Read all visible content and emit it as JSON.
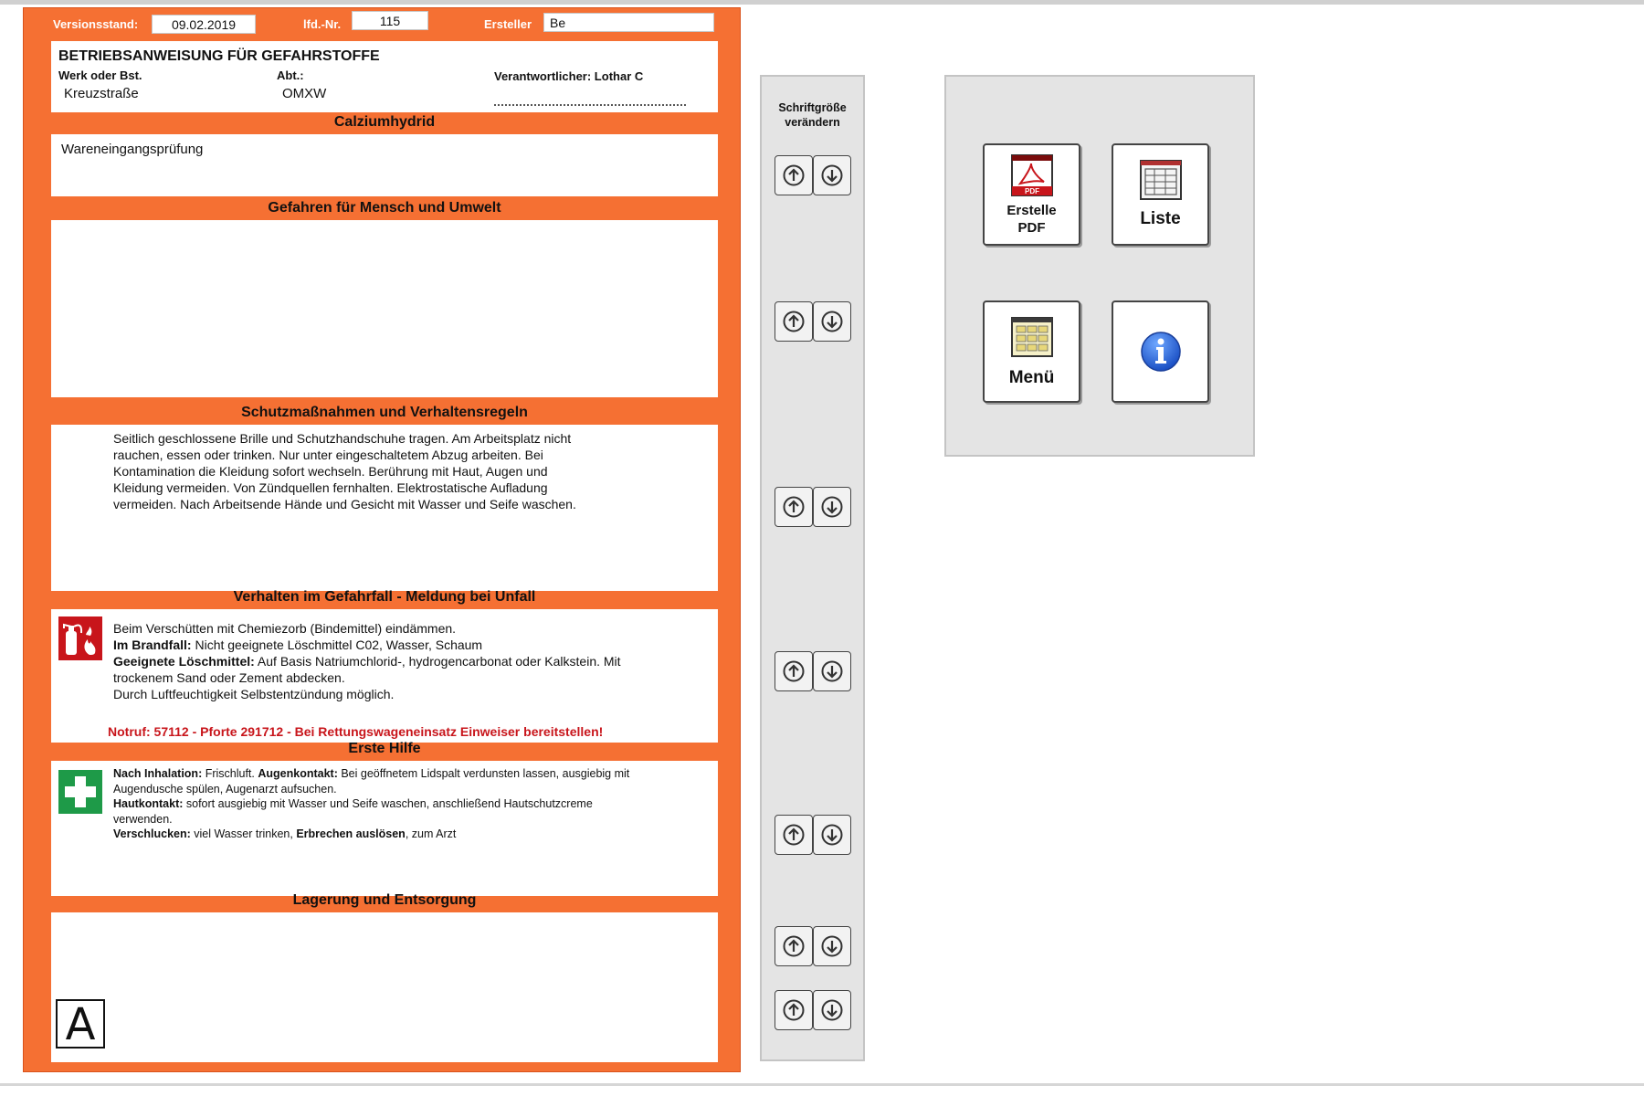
{
  "header": {
    "version_label": "Versionsstand:",
    "version_value": "09.02.2019",
    "number_label": "lfd.-Nr.",
    "number_value": "115",
    "author_label": "Ersteller",
    "author_value": "Be"
  },
  "info": {
    "title": "BETRIEBSANWEISUNG FÜR GEFAHRSTOFFE",
    "site_label": "Werk oder Bst.",
    "site_value": "Kreuzstraße",
    "dept_label": "Abt.:",
    "dept_value": "OMXW",
    "responsible_label": "Verantwortlicher: Lothar C"
  },
  "substance": {
    "name": "Calziumhydrid",
    "usage": "Wareneingangsprüfung"
  },
  "sections": {
    "hazards": "Gefahren für Mensch und Umwelt",
    "protection": "Schutzmaßnahmen und Verhaltensregeln",
    "emergency": "Verhalten  im Gefahrfall - Meldung bei Unfall",
    "first_aid": "Erste Hilfe",
    "storage": "Lagerung und Entsorgung"
  },
  "protection_text": [
    "Seitlich geschlossene Brille und Schutzhandschuhe tragen. Am Arbeitsplatz nicht",
    "rauchen, essen oder trinken. Nur unter eingeschaltetem Abzug arbeiten. Bei",
    "Kontamination die Kleidung sofort wechseln. Berührung mit Haut, Augen und",
    "Kleidung vermeiden. Von Zündquellen fernhalten. Elektrostatische Aufladung",
    "vermeiden. Nach Arbeitsende Hände und Gesicht mit Wasser und Seife waschen."
  ],
  "emergency_text": {
    "line1": "Beim Verschütten mit Chemiezorb (Bindemittel) eindämmen.",
    "fire_label": "Im Brandfall:",
    "fire_text": " Nicht geeignete Löschmittel C02, Wasser, Schaum",
    "agent_label": "Geeignete Löschmittel:",
    "agent_text": "  Auf Basis Natriumchlorid-, hydrogencarbonat oder Kalkstein. Mit",
    "line4": "trockenem Sand oder Zement abdecken.",
    "line5": "Durch Luftfeuchtigkeit Selbstentzündung möglich.",
    "notruf": "Notruf: 57112 - Pforte 291712 - Bei Rettungswageneinsatz Einweiser bereitstellen!"
  },
  "first_aid_text": {
    "inhal_label": "Nach Inhalation:",
    "inhal_text": " Frischluft. ",
    "eye_label": "Augenkontakt:",
    "eye_text": " Bei geöffnetem Lidspalt verdunsten lassen, ausgiebig mit",
    "eye_text2": "Augendusche  spülen,  Augenarzt aufsuchen.",
    "skin_label": "Hautkontakt:",
    "skin_text": " sofort ausgiebig mit Wasser und Seife waschen, anschließend   Hautschutzcreme",
    "skin_text2": "verwenden.",
    "swallow_label": "Verschlucken:",
    "swallow_text": " viel Wasser trinken, ",
    "vomit_label": "Erbrechen auslösen",
    "swallow_text2": ", zum Arzt"
  },
  "storage_symbol": "A",
  "font_strip": {
    "title_line1": "Schriftgröße",
    "title_line2": "verändern"
  },
  "actions": {
    "pdf_line1": "Erstelle",
    "pdf_line2": "PDF",
    "pdf_icon_text": "PDF",
    "list": "Liste",
    "menu": "Menü"
  },
  "icons": {
    "increase": "arrow-up-circle-icon",
    "decrease": "arrow-down-circle-icon",
    "pdf": "pdf-document-icon",
    "list": "list-document-icon",
    "menu": "menu-grid-icon",
    "info": "info-icon",
    "fire": "fire-extinguisher-icon",
    "first_aid": "first-aid-cross-icon"
  },
  "colors": {
    "form_orange": "#f57033",
    "notruf_red": "#c8151b",
    "fire_red": "#c8151b",
    "first_aid_green": "#1e9a48",
    "info_blue": "#1a5fd6"
  }
}
